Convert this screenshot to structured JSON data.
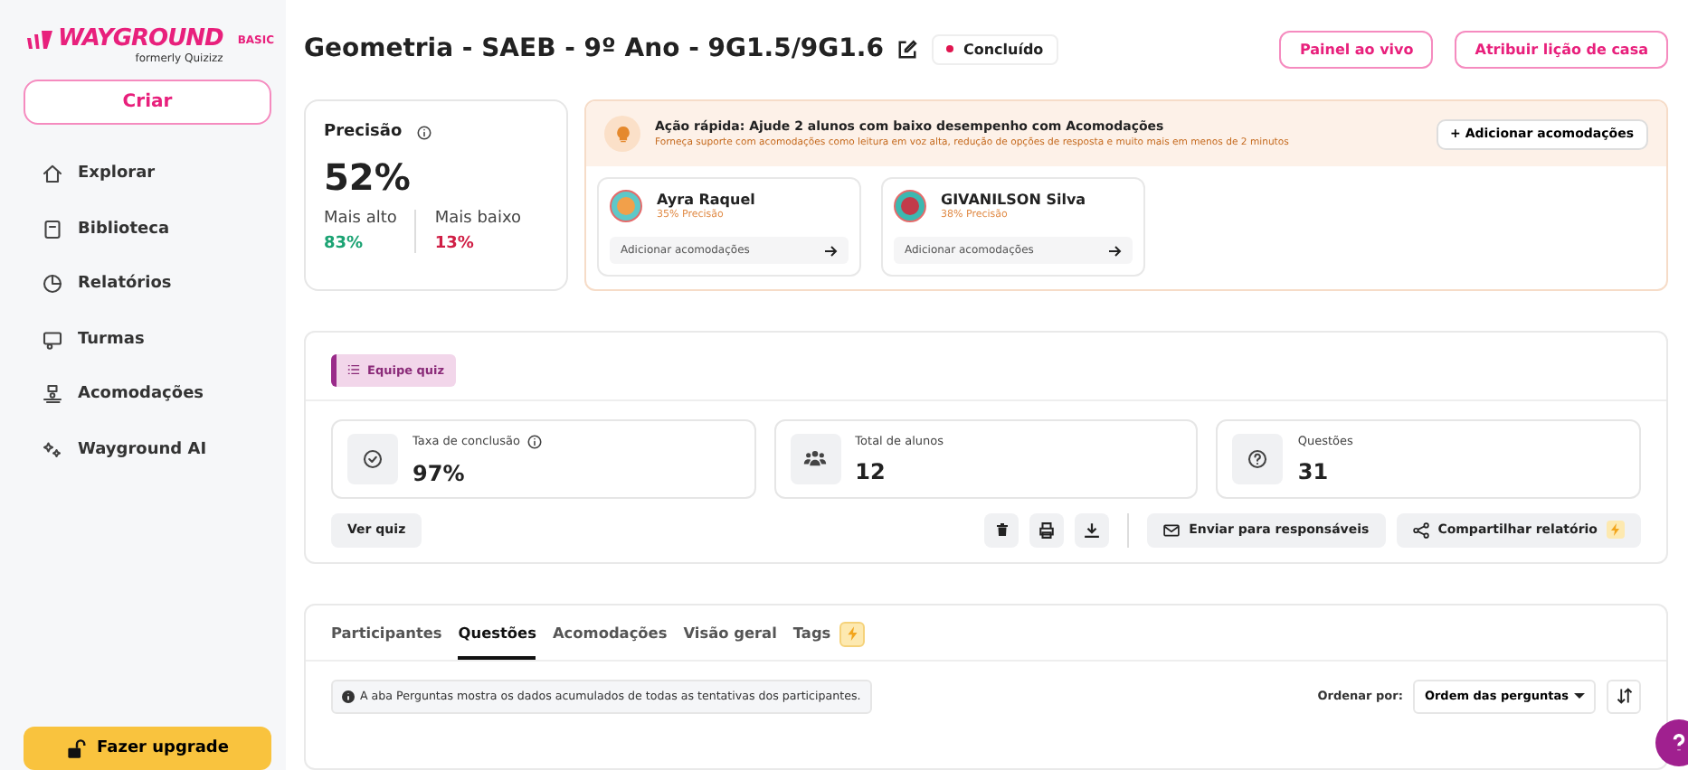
{
  "sidebar": {
    "logo": {
      "brand": "WAYGROUND",
      "badge": "BASIC",
      "subtitle": "formerly Quizizz"
    },
    "create_button": "Criar",
    "items": [
      {
        "label": "Explorar"
      },
      {
        "label": "Biblioteca"
      },
      {
        "label": "Relatórios"
      },
      {
        "label": "Turmas"
      },
      {
        "label": "Acomodações"
      },
      {
        "label": "Wayground AI"
      }
    ],
    "upgrade_button": "Fazer upgrade"
  },
  "header": {
    "title": "Geometria - SAEB - 9º Ano - 9G1.5/9G1.6",
    "status": "Concluído",
    "buttons": [
      "Painel ao vivo",
      "Atribuir lição de casa"
    ]
  },
  "accuracy": {
    "label": "Precisão",
    "value": "52%",
    "highest": {
      "label": "Mais alto",
      "value": "83%"
    },
    "lowest": {
      "label": "Mais baixo",
      "value": "13%"
    }
  },
  "quick_action": {
    "title": "Ação rápida: Ajude 2 alunos com baixo desempenho com Acomodações",
    "subtitle": "Forneça suporte com acomodações como leitura em voz alta, redução de opções de resposta e muito mais em menos de 2 minutos",
    "add_button": "+ Adicionar acomodações",
    "students": [
      {
        "name": "Ayra Raquel",
        "accuracy": "35% Precisão",
        "action": "Adicionar acomodações"
      },
      {
        "name": "GIVANILSON Silva",
        "accuracy": "38% Precisão",
        "action": "Adicionar acomodações"
      }
    ]
  },
  "quiz": {
    "tag": "Equipe quiz",
    "stats": [
      {
        "label": "Taxa de conclusão",
        "value": "97%",
        "info": true
      },
      {
        "label": "Total de alunos",
        "value": "12",
        "info": false
      },
      {
        "label": "Questões",
        "value": "31",
        "info": false
      }
    ],
    "view_button": "Ver quiz",
    "send_button": "Enviar para responsáveis",
    "share_button": "Compartilhar relatório"
  },
  "tabs": [
    {
      "label": "Participantes",
      "selected": false
    },
    {
      "label": "Questões",
      "selected": true
    },
    {
      "label": "Acomodações",
      "selected": false
    },
    {
      "label": "Visão geral",
      "selected": false
    },
    {
      "label": "Tags",
      "selected": false
    }
  ],
  "notice": "A aba Perguntas mostra os dados acumulados de todas as tentativas dos participantes.",
  "sort": {
    "label": "Ordenar por:",
    "value": "Ordem das perguntas"
  }
}
